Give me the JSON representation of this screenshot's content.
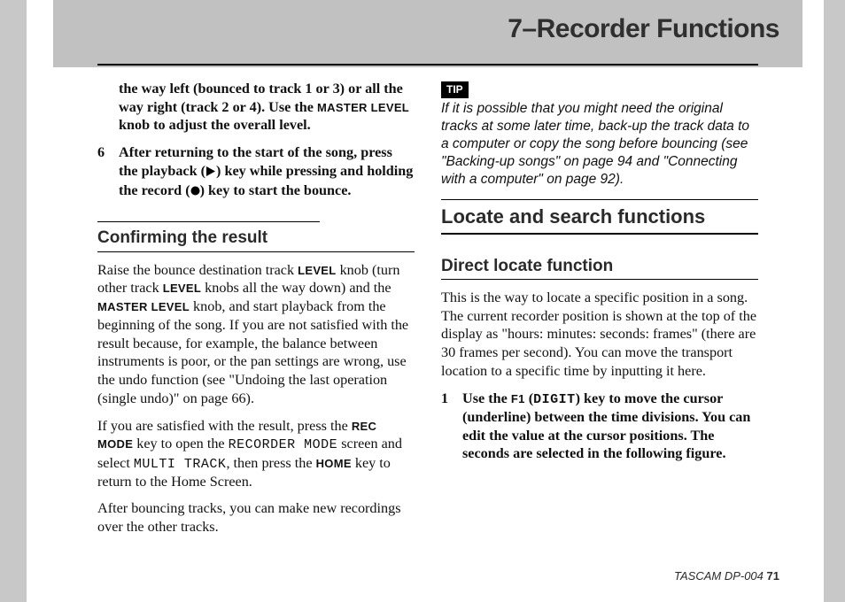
{
  "chapter": {
    "title": "7–Recorder Functions"
  },
  "left": {
    "cont_para": "the way left (bounced to track 1 or 3) or all the way right (track 2 or 4). Use the ",
    "master_level": "MASTER LEVEL",
    "cont_para_2": " knob to adjust the overall level.",
    "step6_num": "6",
    "step6_a": "After returning to the start of the song, press the playback (",
    "step6_b": ") key while pressing and holding the record (",
    "step6_c": ") key to start the bounce.",
    "confirm_head": "Confirming the result",
    "p1a": "Raise the bounce destination track ",
    "level": "LEVEL",
    "p1b": " knob (turn other track ",
    "p1c": " knobs all the way down) and the ",
    "p1d": " knob, and start playback from the beginning of the song. If you are not satisfied with the result because, for example, the balance between instruments is poor, or the pan settings are wrong, use the undo function (see \"Undoing the last operation (single undo)\" on page 66).",
    "p2a": "If you are satisfied with the result, press the ",
    "rec_mode": "REC MODE",
    "p2b": " key to open the ",
    "recorder_mode": "RECORDER MODE",
    "p2c": " screen and select ",
    "multi_track": "MULTI TRACK",
    "p2d": ", then press the ",
    "home": "HOME",
    "p2e": " key to return to the Home Screen.",
    "p3": "After bouncing tracks, you can make new recordings over the other tracks."
  },
  "right": {
    "tip_label": "TIP",
    "tip_text": "If it is possible that you might need the original tracks at some later time, back-up the track data to a computer or copy the song before bouncing (see \"Backing-up songs\" on page 94 and \"Connecting with a computer\" on page 92).",
    "section_head": "Locate and search functions",
    "direct_head": "Direct locate function",
    "p1": "This is the way to locate a specific position in a song. The current recorder position is shown at the top of the display as \"hours: minutes: seconds: frames\" (there are 30 frames per second). You can move the transport location to a specific time by inputting it here.",
    "step1_num": "1",
    "step1a": "Use the ",
    "f1": "F1",
    "step1b": " (",
    "digit": "DIGIT",
    "step1c": ") key to move the cursor (underline) between the time divisions. You can edit the value at the cursor positions. The seconds are selected in the following figure."
  },
  "footer": {
    "brand": "TASCAM  DP-004",
    "page": "71"
  }
}
